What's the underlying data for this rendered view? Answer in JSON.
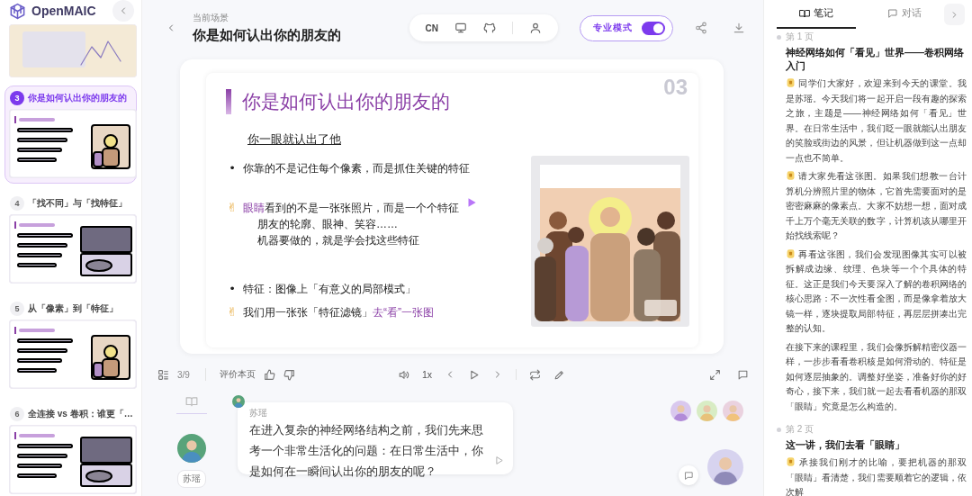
{
  "app": {
    "logo": "OpenMAIC"
  },
  "sidebar": {
    "slides": [
      {
        "number": "3",
        "title": "你是如何认出你的朋友的",
        "selected": true
      },
      {
        "number": "4",
        "title": "「找不同」与「找特征」",
        "selected": false
      },
      {
        "number": "5",
        "title": "从「像素」到「特征」",
        "selected": false
      },
      {
        "number": "6",
        "title": "全连接 vs 卷积：谁更「…",
        "selected": false
      }
    ]
  },
  "header": {
    "caption": "当前场景",
    "title": "你是如何认出你的朋友的",
    "language": "CN",
    "mode": {
      "label": "专业模式",
      "on": true
    }
  },
  "slide": {
    "title": "你是如何认出你的朋友的",
    "number": "03",
    "subtitle": "你一眼就认出了他",
    "points": [
      {
        "kind": "bullet",
        "marker": "•",
        "parts": [
          {
            "text": "你靠的不是记住每个像素，而是抓住关键的特征",
            "accent": false
          }
        ]
      },
      {
        "kind": "hand",
        "marker": "✌",
        "parts": [
          {
            "text": "眼睛",
            "accent": true
          },
          {
            "text": "看到的不是一张张照片，而是一个个特征",
            "accent": false
          }
        ],
        "lines": [
          "朋友的轮廓、眼神、笑容……",
          "机器要做的，就是学会找这些特征"
        ]
      },
      {
        "kind": "bullet",
        "marker": "•",
        "parts": [
          {
            "text": "特征：图像上「有意义的局部模式」",
            "accent": false
          }
        ]
      },
      {
        "kind": "hand",
        "marker": "✌",
        "parts": [
          {
            "text": "我们用一张张「特征滤镜」",
            "accent": false
          },
          {
            "text": "去“看”一张图",
            "accent": true
          }
        ]
      }
    ]
  },
  "controls": {
    "page": "3/9",
    "rate_label": "评价本页",
    "speed": "1x"
  },
  "chat": {
    "speaker_tag": "苏瑶",
    "bubble_name": "苏瑶",
    "message": "在进入复杂的神经网络结构之前，我们先来思考一个非常生活化的问题：在日常生活中，你是如何在一瞬间认出你的朋友的呢？"
  },
  "notes": {
    "tabs": [
      {
        "label": "笔记",
        "selected": true
      },
      {
        "label": "对话",
        "selected": false
      }
    ],
    "sections": [
      {
        "page": "第 1 页",
        "heading": "神经网络如何「看见」世界——卷积网络入门",
        "paragraphs": [
          {
            "kind": "speech",
            "text": "同学们大家好，欢迎来到今天的课堂。我是苏瑶。今天我们将一起开启一段有趣的探索之旅，主题是——神经网络如何「看见」世界。在日常生活中，我们眨一眼就能认出朋友的笑脸或街边的风景，但让机器做到这一点却一点也不简单。"
          },
          {
            "kind": "speech",
            "text": "请大家先看这张图。如果我们想教一台计算机分辨照片里的物体，它首先需要面对的是密密麻麻的像素点。大家不妨想一想，面对成千上万个毫无关联的数字，计算机该从哪里开始找线索呢？"
          },
          {
            "kind": "speech",
            "text": "再看这张图，我们会发现图像其实可以被拆解成边缘、纹理、色块等一个个具体的特征。这正是我们今天要深入了解的卷积网络的核心思路：不一次性看全图，而是像拿着放大镜一样，逐块提取局部特征，再层层拼凑出完整的认知。"
          },
          {
            "kind": "plain",
            "text": "在接下来的课程里，我们会像拆解精密仪器一样，一步步看看卷积核是如何滑动的、特征是如何逐层抽象的。调整好坐姿，准备好你的好奇心，接下来，我们就一起去看看机器的那双「眼睛」究竟是怎么构造的。"
          }
        ]
      },
      {
        "page": "第 2 页",
        "heading": "这一讲，我们去看「眼睛」",
        "paragraphs": [
          {
            "kind": "speech",
            "text": "承接我们刚才的比喻，要把机器的那双「眼睛」看清楚，我们需要顺着它的逻辑，依次解"
          }
        ]
      }
    ]
  }
}
